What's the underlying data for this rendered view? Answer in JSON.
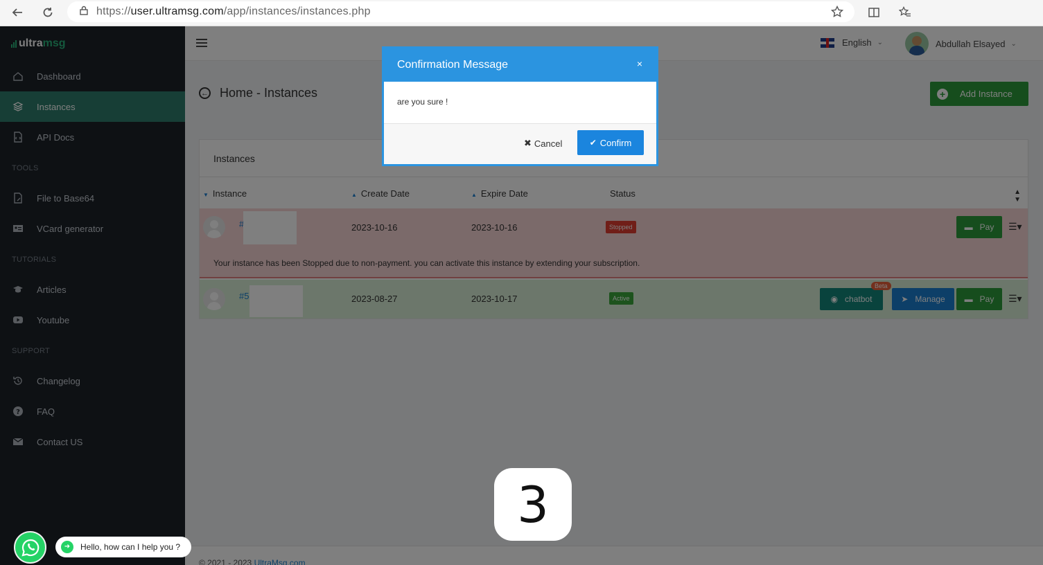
{
  "browser": {
    "url_prefix": "https://",
    "url_host": "user.ultramsg.com",
    "url_path": "/app/instances/instances.php"
  },
  "sidebar": {
    "logo_ultra": "ultra",
    "logo_msg": "msg",
    "items": [
      {
        "label": "Dashboard"
      },
      {
        "label": "Instances"
      },
      {
        "label": "API Docs"
      },
      {
        "label": "File to Base64"
      },
      {
        "label": "VCard generator"
      },
      {
        "label": "Articles"
      },
      {
        "label": "Youtube"
      },
      {
        "label": "Changelog"
      },
      {
        "label": "FAQ"
      },
      {
        "label": "Contact US"
      }
    ],
    "sections": [
      "TOOLS",
      "TUTORIALS",
      "SUPPORT"
    ]
  },
  "topbar": {
    "language": "English",
    "user_name": "Abdullah Elsayed"
  },
  "page": {
    "title": "Home - Instances",
    "add_button": "Add Instance"
  },
  "table": {
    "card_title": "Instances",
    "headers": [
      "Instance",
      "Create Date",
      "Expire Date",
      "Status"
    ],
    "rows": [
      {
        "id": "#",
        "create_date": "2023-10-16",
        "expire_date": "2023-10-16",
        "status": "Stopped",
        "pay": "Pay",
        "note": "Your instance has been Stopped due to non-payment. you can activate this instance by extending your subscription."
      },
      {
        "id": "#5",
        "create_date": "2023-08-27",
        "expire_date": "2023-10-17",
        "status": "Active",
        "pay": "Pay",
        "chatbot": "chatbot",
        "beta": "Beta",
        "manage": "Manage"
      }
    ]
  },
  "footer": {
    "copyright": "© 2021 - 2023",
    "link": "UltraMsg.com"
  },
  "modal": {
    "title": "Confirmation Message",
    "close": "×",
    "message": "are you sure !",
    "cancel": "Cancel",
    "confirm": "Confirm"
  },
  "countdown": {
    "value": "3"
  },
  "whatsapp": {
    "message": "Hello, how can I help you ?"
  },
  "colors": {
    "sidebar_bg": "#1c2229",
    "active_item": "#2f7d6c",
    "modal_header": "#2b94e0",
    "confirm_button": "#1b85de",
    "pay_button": "#2c9a3a",
    "stopped_badge": "#e03c31",
    "active_badge": "#3aa63a"
  }
}
